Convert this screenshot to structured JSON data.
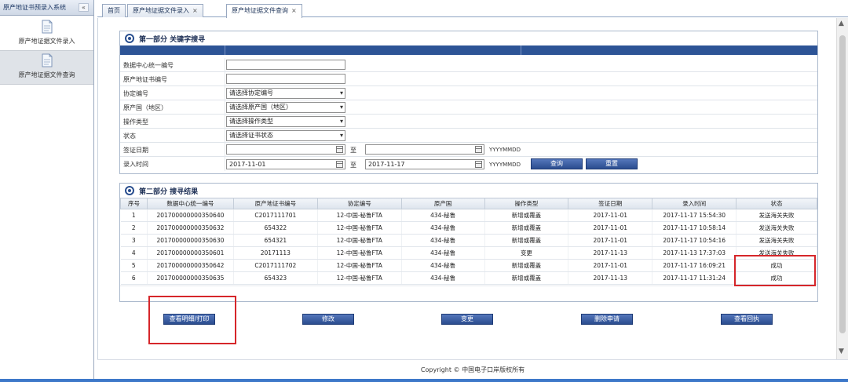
{
  "sidebar": {
    "title": "原产地证书预录入系统",
    "collapse_glyph": "«",
    "items": [
      {
        "label": "原产地证据文件录入",
        "icon": "document-icon"
      },
      {
        "label": "原产地证据文件查询",
        "icon": "document-icon"
      }
    ]
  },
  "tabs": [
    {
      "label": "首页",
      "closable": false
    },
    {
      "label": "原产地证据文件录入",
      "closable": true
    },
    {
      "label": "原产地证据文件查询",
      "closable": true,
      "active": true
    }
  ],
  "tab_close_glyph": "×",
  "search": {
    "title": "第一部分 关键字搜寻",
    "fields": {
      "data_center_id": {
        "label": "数据中心统一编号",
        "value": ""
      },
      "certificate_no": {
        "label": "原产地证书编号",
        "value": ""
      },
      "agreement_no": {
        "label": "协定编号",
        "value": "请选择协定编号"
      },
      "origin_country": {
        "label": "原产国（地区）",
        "value": "请选择原产国（地区）"
      },
      "operation_type": {
        "label": "操作类型",
        "value": "请选择操作类型"
      },
      "status": {
        "label": "状态",
        "value": "请选择证书状态"
      },
      "issue_date": {
        "label": "签证日期",
        "from": "",
        "to": "",
        "format": "YYYYMMDD"
      },
      "entry_time": {
        "label": "录入时间",
        "from": "2017-11-01",
        "to": "2017-11-17",
        "format": "YYYYMMDD"
      }
    },
    "to_label": "至",
    "query_button": "查询",
    "reset_button": "重置"
  },
  "results": {
    "title": "第二部分 搜寻结果",
    "columns": [
      "序号",
      "数据中心统一编号",
      "原产地证书编号",
      "协定编号",
      "原产国",
      "操作类型",
      "签证日期",
      "录入时间",
      "状态"
    ],
    "rows": [
      [
        "1",
        "201700000000350640",
        "C2017111701",
        "12-中国-秘鲁FTA",
        "434-秘鲁",
        "新增或覆盖",
        "2017-11-01",
        "2017-11-17 15:54:30",
        "发送海关失败"
      ],
      [
        "2",
        "201700000000350632",
        "654322",
        "12-中国-秘鲁FTA",
        "434-秘鲁",
        "新增或覆盖",
        "2017-11-01",
        "2017-11-17 10:58:14",
        "发送海关失败"
      ],
      [
        "3",
        "201700000000350630",
        "654321",
        "12-中国-秘鲁FTA",
        "434-秘鲁",
        "新增或覆盖",
        "2017-11-01",
        "2017-11-17 10:54:16",
        "发送海关失败"
      ],
      [
        "4",
        "201700000000350601",
        "20171113",
        "12-中国-秘鲁FTA",
        "434-秘鲁",
        "变更",
        "2017-11-13",
        "2017-11-13 17:37:03",
        "发送海关失败"
      ],
      [
        "5",
        "201700000000350642",
        "C2017111702",
        "12-中国-秘鲁FTA",
        "434-秘鲁",
        "新增或覆盖",
        "2017-11-01",
        "2017-11-17 16:09:21",
        "成功"
      ],
      [
        "6",
        "201700000000350635",
        "654323",
        "12-中国-秘鲁FTA",
        "434-秘鲁",
        "新增或覆盖",
        "2017-11-13",
        "2017-11-17 11:31:24",
        "成功"
      ]
    ]
  },
  "actions": {
    "view_print": "查看明细/打印",
    "modify": "修改",
    "change": "变更",
    "delete_request": "删除申请",
    "view_receipt": "查看回执"
  },
  "footer": {
    "copyright": "Copyright © 中国电子口岸版权所有"
  },
  "colors": {
    "accent": "#2d5496",
    "highlight": "#d6262a"
  }
}
